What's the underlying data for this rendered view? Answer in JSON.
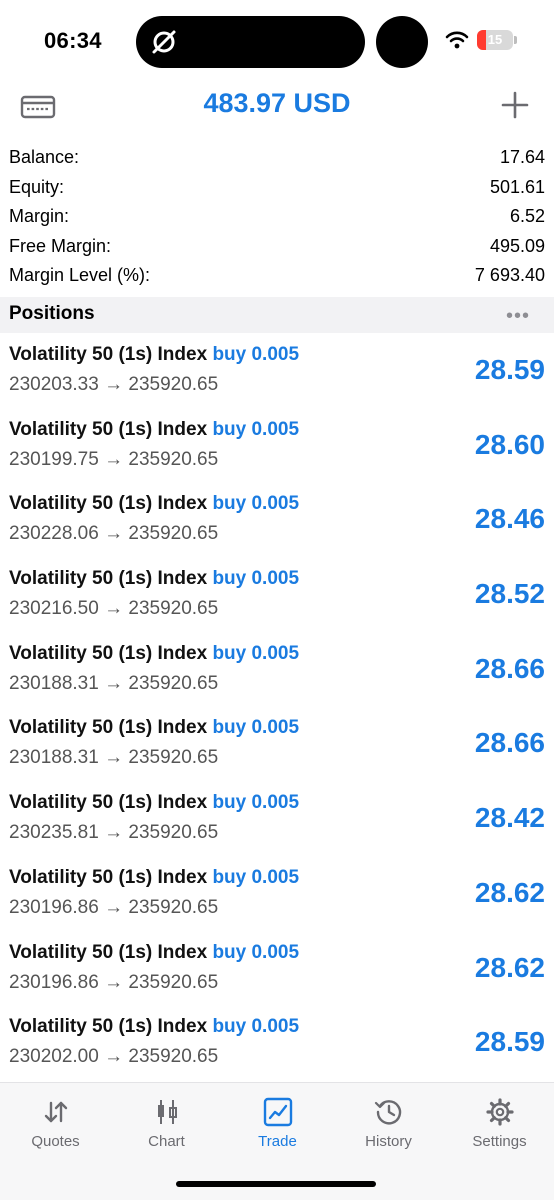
{
  "status_bar": {
    "time": "06:34",
    "battery_level": "15",
    "battery_color": "#ff3b30"
  },
  "header": {
    "title": "483.97 USD",
    "left_icon": "card-icon",
    "right_icon": "plus-icon"
  },
  "summary": [
    {
      "label": "Balance:",
      "value": "17.64"
    },
    {
      "label": "Equity:",
      "value": "501.61"
    },
    {
      "label": "Margin:",
      "value": "6.52"
    },
    {
      "label": "Free Margin:",
      "value": "495.09"
    },
    {
      "label": "Margin Level (%):",
      "value": "7 693.40"
    }
  ],
  "positions_section": {
    "title": "Positions",
    "more_icon": "ellipsis-icon"
  },
  "positions": [
    {
      "symbol": "Volatility 50 (1s) Index",
      "side": "buy 0.005",
      "prices": "230203.33 → 235920.65",
      "profit": "28.59"
    },
    {
      "symbol": "Volatility 50 (1s) Index",
      "side": "buy 0.005",
      "prices": "230199.75 → 235920.65",
      "profit": "28.60"
    },
    {
      "symbol": "Volatility 50 (1s) Index",
      "side": "buy 0.005",
      "prices": "230228.06 → 235920.65",
      "profit": "28.46"
    },
    {
      "symbol": "Volatility 50 (1s) Index",
      "side": "buy 0.005",
      "prices": "230216.50 → 235920.65",
      "profit": "28.52"
    },
    {
      "symbol": "Volatility 50 (1s) Index",
      "side": "buy 0.005",
      "prices": "230188.31 → 235920.65",
      "profit": "28.66"
    },
    {
      "symbol": "Volatility 50 (1s) Index",
      "side": "buy 0.005",
      "prices": "230188.31 → 235920.65",
      "profit": "28.66"
    },
    {
      "symbol": "Volatility 50 (1s) Index",
      "side": "buy 0.005",
      "prices": "230235.81 → 235920.65",
      "profit": "28.42"
    },
    {
      "symbol": "Volatility 50 (1s) Index",
      "side": "buy 0.005",
      "prices": "230196.86 → 235920.65",
      "profit": "28.62"
    },
    {
      "symbol": "Volatility 50 (1s) Index",
      "side": "buy 0.005",
      "prices": "230196.86 → 235920.65",
      "profit": "28.62"
    },
    {
      "symbol": "Volatility 50 (1s) Index",
      "side": "buy 0.005",
      "prices": "230202.00 → 235920.65",
      "profit": "28.59"
    }
  ],
  "tabbar": [
    {
      "label": "Quotes",
      "icon": "quotes-arrows-icon",
      "active": false
    },
    {
      "label": "Chart",
      "icon": "candlestick-icon",
      "active": false
    },
    {
      "label": "Trade",
      "icon": "trade-chart-icon",
      "active": true
    },
    {
      "label": "History",
      "icon": "history-clock-icon",
      "active": false
    },
    {
      "label": "Settings",
      "icon": "gear-icon",
      "active": false
    }
  ],
  "colors": {
    "accent": "#1a7be0",
    "inactive": "#6b6b70",
    "section_bg": "#f2f2f4"
  }
}
